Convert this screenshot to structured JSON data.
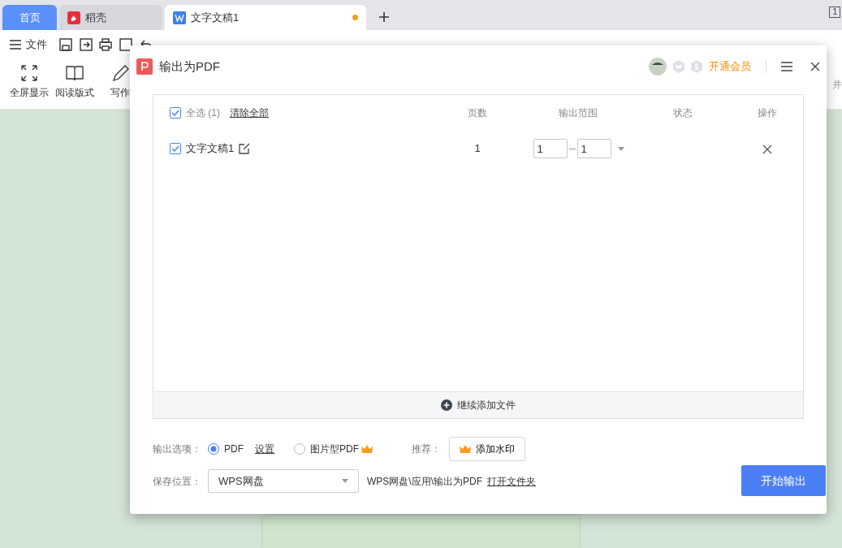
{
  "app_tabs": [
    {
      "label": "首页",
      "kind": "home",
      "selected": false
    },
    {
      "label": "稻壳",
      "kind": "docer",
      "selected": false
    },
    {
      "label": "文字文稿1",
      "kind": "doc",
      "selected": true,
      "unsaved": true
    }
  ],
  "page_counter": "1",
  "file_menu": "文件",
  "ribbon_buttons": [
    {
      "label": "全屏显示",
      "kind": "fullscreen"
    },
    {
      "label": "阅读版式",
      "kind": "book"
    },
    {
      "label": "写作",
      "kind": "pen"
    }
  ],
  "ribbon_right": "并",
  "dialog": {
    "title": "输出为PDF",
    "member_link": "开通会员",
    "table": {
      "select_all": {
        "label": "全选 (1)",
        "checked": true
      },
      "clear_all": "清除全部",
      "columns": [
        "页数",
        "输出范围",
        "状态",
        "操作"
      ],
      "rows": [
        {
          "name": "文字文稿1",
          "checked": true,
          "pages": "1",
          "range_from": "1",
          "range_to": "1"
        }
      ]
    },
    "add_files": "继续添加文件",
    "output_options": {
      "label": "输出选项：",
      "choices": [
        {
          "label": "PDF",
          "selected": true,
          "premium": false
        },
        {
          "label": "图片型PDF",
          "selected": false,
          "premium": true
        }
      ],
      "settings_link": "设置"
    },
    "recommend": {
      "label": "推荐：",
      "button": "添加水印"
    },
    "save_location": {
      "label": "保存位置：",
      "value": "WPS网盘",
      "path": "WPS网盘\\应用\\输出为PDF",
      "open_link": "打开文件夹"
    },
    "start_button": "开始输出"
  }
}
